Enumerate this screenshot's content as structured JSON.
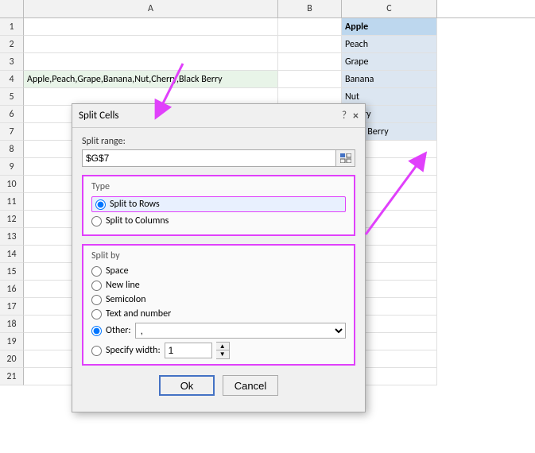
{
  "spreadsheet": {
    "col_headers": [
      "",
      "A",
      "B",
      "C"
    ],
    "rows": [
      1,
      2,
      3,
      4,
      5,
      6,
      7,
      8,
      9,
      10,
      11,
      12,
      13,
      14,
      15,
      16,
      17,
      18,
      19,
      20,
      21
    ],
    "row4_content": "Apple,Peach,Grape,Banana,Nut,Cherry,Black Berry",
    "col_c_data": [
      "Apple",
      "Peach",
      "Grape",
      "Banana",
      "Nut",
      "Cherry",
      "Black Berry"
    ]
  },
  "dialog": {
    "title": "Split Cells",
    "help": "?",
    "close": "×",
    "split_range_label": "Split range:",
    "split_range_value": "$G$7",
    "type_label": "Type",
    "type_options": [
      {
        "label": "Split to Rows",
        "selected": true
      },
      {
        "label": "Split to Columns",
        "selected": false
      }
    ],
    "split_by_label": "Split by",
    "split_by_options": [
      {
        "label": "Space",
        "selected": false
      },
      {
        "label": "New line",
        "selected": false
      },
      {
        "label": "Semicolon",
        "selected": false
      },
      {
        "label": "Text and number",
        "selected": false
      },
      {
        "label": "Other:",
        "selected": true
      },
      {
        "label": "Specify width:",
        "selected": false
      }
    ],
    "other_value": ",",
    "width_value": "1",
    "ok_label": "Ok",
    "cancel_label": "Cancel"
  }
}
